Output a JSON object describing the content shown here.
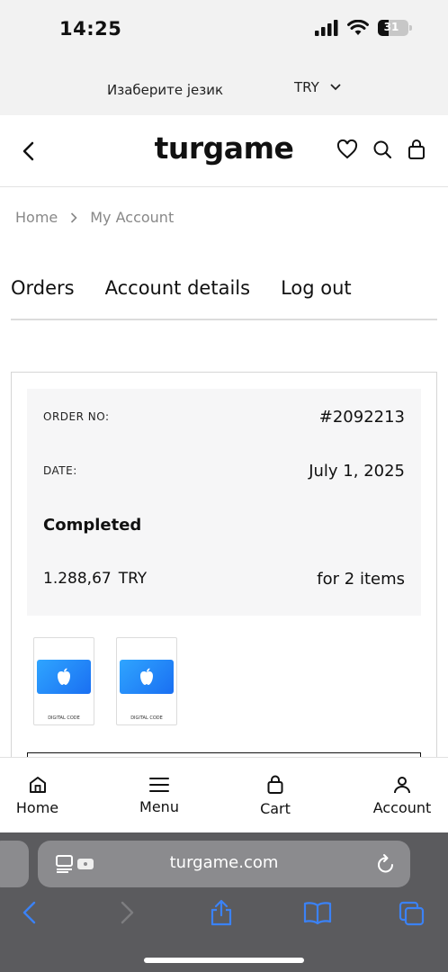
{
  "status_bar": {
    "time": "14:25",
    "battery": "31"
  },
  "language_bar": {
    "label": "Изаберите језик",
    "currency": "TRY"
  },
  "header": {
    "logo": "turgame"
  },
  "breadcrumb": {
    "home": "Home",
    "current": "My Account"
  },
  "account_tabs": [
    "Orders",
    "Account details",
    "Log out"
  ],
  "order": {
    "order_no_label": "ORDER NO:",
    "order_no": "#2092213",
    "date_label": "DATE:",
    "date": "July 1, 2025",
    "status": "Completed",
    "total_amount": "1.288,67",
    "total_currency": "TRY",
    "items_text": "for 2 items",
    "items": [
      {
        "caption": "DIGITAL CODE"
      },
      {
        "caption": "DIGITAL CODE"
      }
    ]
  },
  "bottom_nav": {
    "home": "Home",
    "menu": "Menu",
    "cart": "Cart",
    "account": "Account"
  },
  "browser": {
    "url": "turgame.com"
  },
  "colors": {
    "accent_blue": "#1a6ff2",
    "safari_bar": "#5b5b5e"
  }
}
